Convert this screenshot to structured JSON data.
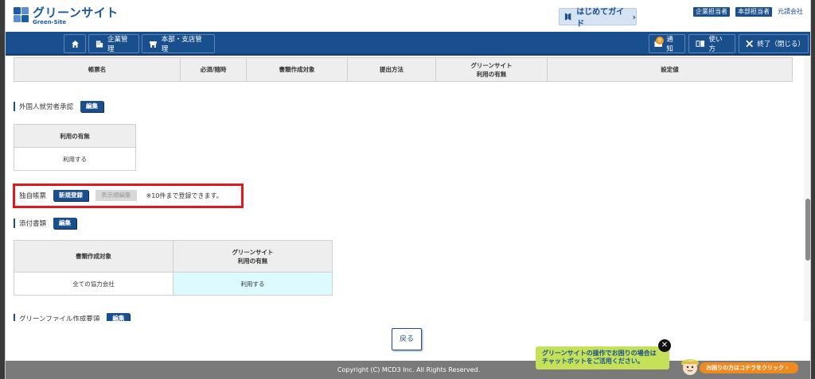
{
  "header": {
    "logo_jp": "グリーンサイト",
    "logo_en": "Green-Site",
    "guide_label": "はじめてガイド",
    "roles": [
      "企業担当者",
      "本部担当者"
    ],
    "company_link": "元請会社"
  },
  "nav": {
    "home_label": "",
    "company_mgmt": "企業管理",
    "branch_mgmt": "本部・支店管理",
    "notify_label": "通知",
    "notify_count": "8",
    "howto_label": "使い方",
    "exit_label": "終了（閉じる）"
  },
  "forms_table": {
    "headers": [
      "帳票名",
      "必須/随時",
      "書類作成対象",
      "提出方法",
      "グリーンサイト",
      "利用の有無",
      "設定値"
    ]
  },
  "foreign_section": {
    "title": "外国人就労者承認",
    "edit_label": "編集",
    "table_header": "利用の有無",
    "table_value": "利用する"
  },
  "original_section": {
    "title": "独自帳票",
    "new_label": "新規登録",
    "order_label": "表示順編集",
    "note": "※10件まで登録できます。"
  },
  "attachment_section": {
    "title": "添付書類",
    "edit_label": "編集",
    "headers": [
      "書類作成対象",
      "グリーンサイト",
      "利用の有無"
    ],
    "row": [
      "全ての協力会社",
      "利用する"
    ]
  },
  "greenfile_section": {
    "title": "グリーンファイル作成要領",
    "edit_label": "編集"
  },
  "footer": {
    "back_label": "戻る",
    "copyright": "Copyright (C) MCD3 Inc. All Rights Reserved.",
    "chat_line1": "グリーンサイトの操作でお困りの場合は",
    "chat_line2": "チャットボットをご活用ください。",
    "chat_button": "お困りの方はコチラをクリック ›",
    "chat_close": "✕"
  },
  "colors": {
    "primary": "#1a4f8d",
    "highlight": "#e0191f",
    "cell_highlight": "#ddfaff",
    "chat_green": "#c5e15a",
    "chat_orange": "#f08a1e"
  }
}
